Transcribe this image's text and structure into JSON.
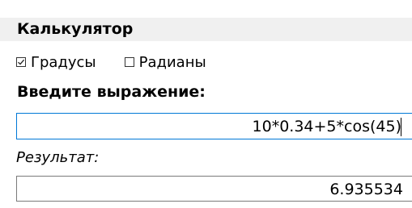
{
  "header": {
    "title": "Калькулятор"
  },
  "units": {
    "degrees": {
      "label": "Градусы",
      "checked": true
    },
    "radians": {
      "label": "Радианы",
      "checked": false
    }
  },
  "input": {
    "label": "Введите выражение:",
    "value": "10*0.34+5*cos(45)"
  },
  "result": {
    "label": "Результат:",
    "value": "6.935534"
  },
  "colors": {
    "header_bg": "#f0f0f0",
    "input_focus_border": "#0078d7",
    "output_border": "#7a7a7a"
  }
}
